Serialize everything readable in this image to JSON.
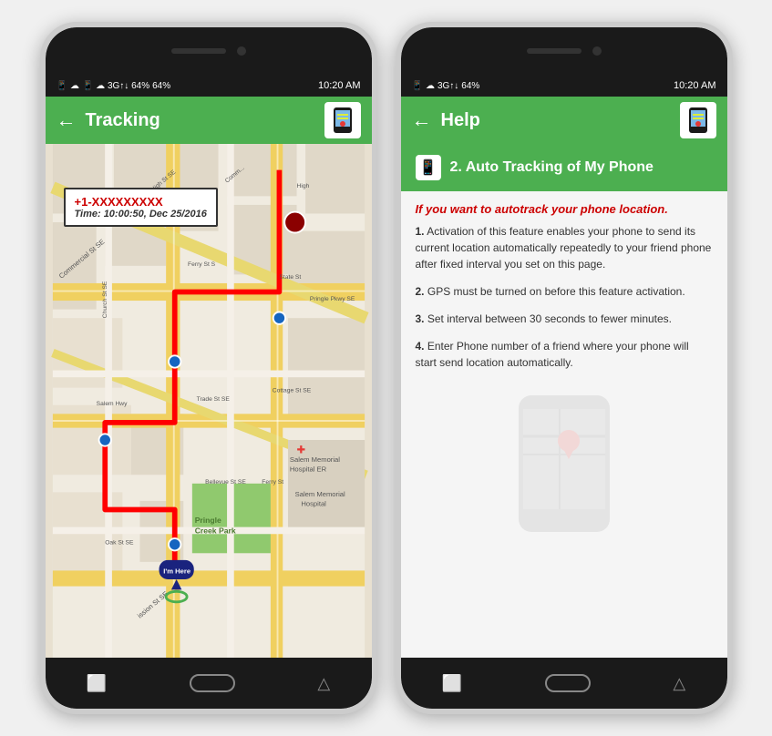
{
  "phone_left": {
    "status_bar": {
      "left_icons": "📱 ☁ 3G↑↓ 64%",
      "time": "10:20 AM"
    },
    "app_bar": {
      "back_label": "←",
      "title": "Tracking",
      "icon_emoji": "📍"
    },
    "map": {
      "popup_phone": "+1-XXXXXXXXX",
      "popup_time": "Time: 10:00:50, Dec 25/2016",
      "im_here_label": "I'm Here"
    },
    "nav": {
      "btn1": "⬜",
      "btn2": "◯",
      "btn3": "△"
    }
  },
  "phone_right": {
    "status_bar": {
      "left_icons": "📱 ☁ 3G↑↓ 64%",
      "time": "10:20 AM"
    },
    "app_bar": {
      "back_label": "←",
      "title": "Help",
      "icon_emoji": "📍"
    },
    "help": {
      "section_number": "2.",
      "section_title": "Auto Tracking of My Phone",
      "subtitle": "If you want to autotrack your phone location.",
      "items": [
        {
          "num": "1.",
          "text": "Activation of this feature enables your phone to send its current location automatically repeatedly to your friend phone after fixed interval you set on this page."
        },
        {
          "num": "2.",
          "text": "GPS must be turned on before this feature activation."
        },
        {
          "num": "3.",
          "text": "Set interval between 30 seconds to fewer minutes."
        },
        {
          "num": "4.",
          "text": "Enter Phone number of a friend where your phone will start send location automatically."
        }
      ]
    }
  }
}
